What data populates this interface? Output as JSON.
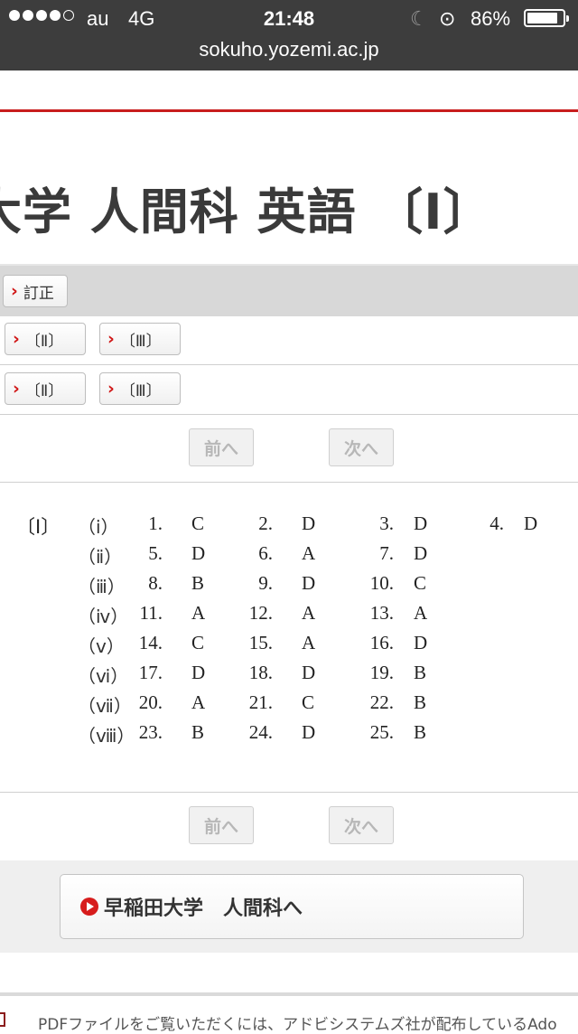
{
  "status_bar": {
    "carrier": "au",
    "network": "4G",
    "time": "21:48",
    "battery_percent": "86%",
    "battery_level": 0.86,
    "signal_bars": 4
  },
  "url_bar": {
    "url": "sokuho.yozemi.ac.jp"
  },
  "page": {
    "title": "大学 人間科 英語 〔Ⅰ〕"
  },
  "nav": {
    "correction_label": "訂正",
    "row1": [
      "〔Ⅱ〕",
      "〔Ⅲ〕"
    ],
    "row2": [
      "〔Ⅱ〕",
      "〔Ⅲ〕"
    ],
    "prev_label": "前へ",
    "next_label": "次へ"
  },
  "answers": {
    "section": "〔Ⅰ〕",
    "rows": [
      {
        "label": "（ⅰ）",
        "items": [
          [
            "1.",
            "C"
          ],
          [
            "2.",
            "D"
          ],
          [
            "3.",
            "D"
          ],
          [
            "4.",
            "D"
          ]
        ]
      },
      {
        "label": "（ⅱ）",
        "items": [
          [
            "5.",
            "D"
          ],
          [
            "6.",
            "A"
          ],
          [
            "7.",
            "D"
          ]
        ]
      },
      {
        "label": "（ⅲ）",
        "items": [
          [
            "8.",
            "B"
          ],
          [
            "9.",
            "D"
          ],
          [
            "10.",
            "C"
          ]
        ]
      },
      {
        "label": "（ⅳ）",
        "items": [
          [
            "11.",
            "A"
          ],
          [
            "12.",
            "A"
          ],
          [
            "13.",
            "A"
          ]
        ]
      },
      {
        "label": "（ⅴ）",
        "items": [
          [
            "14.",
            "C"
          ],
          [
            "15.",
            "A"
          ],
          [
            "16.",
            "D"
          ]
        ]
      },
      {
        "label": "（ⅵ）",
        "items": [
          [
            "17.",
            "D"
          ],
          [
            "18.",
            "D"
          ],
          [
            "19.",
            "B"
          ]
        ]
      },
      {
        "label": "（ⅶ）",
        "items": [
          [
            "20.",
            "A"
          ],
          [
            "21.",
            "C"
          ],
          [
            "22.",
            "B"
          ]
        ]
      },
      {
        "label": "（ⅷ）",
        "items": [
          [
            "23.",
            "B"
          ],
          [
            "24.",
            "D"
          ],
          [
            "25.",
            "B"
          ]
        ]
      }
    ]
  },
  "footer": {
    "main_link": "早稲田大学　人間科へ",
    "pdf_note": "PDFファイルをご覧いただくには、アドビシステムズ社が配布しているAdo"
  }
}
